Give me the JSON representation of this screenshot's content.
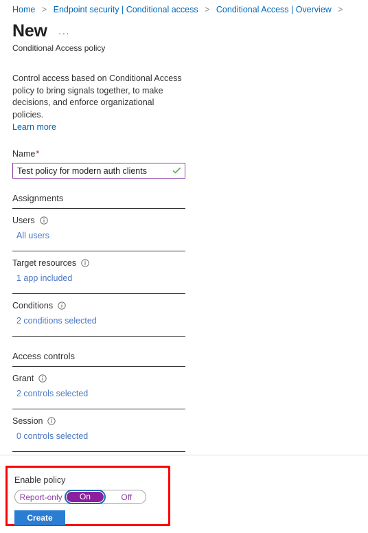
{
  "breadcrumb": {
    "separator": ">",
    "items": [
      {
        "label": "Home"
      },
      {
        "label": "Endpoint security | Conditional access"
      },
      {
        "label": "Conditional Access | Overview"
      }
    ]
  },
  "header": {
    "title": "New",
    "ellipsis": "···",
    "subtitle": "Conditional Access policy"
  },
  "intro": {
    "description": "Control access based on Conditional Access policy to bring signals together, to make decisions, and enforce organizational policies.",
    "learn_more": "Learn more"
  },
  "name_field": {
    "label": "Name",
    "required_marker": "*",
    "value": "Test policy for modern auth clients",
    "placeholder": "",
    "valid_icon": "checkmark-icon",
    "border_color": "#8c3fa0",
    "check_color": "#4caf3f"
  },
  "sections": [
    {
      "heading": "Assignments",
      "rows": [
        {
          "label": "Users",
          "info": "info-icon",
          "value": "All users"
        },
        {
          "label": "Target resources",
          "info": "info-icon",
          "value": "1 app included"
        },
        {
          "label": "Conditions",
          "info": "info-icon",
          "value": "2 conditions selected"
        }
      ]
    },
    {
      "heading": "Access controls",
      "rows": [
        {
          "label": "Grant",
          "info": "info-icon",
          "value": "2 controls selected"
        },
        {
          "label": "Session",
          "info": "info-icon",
          "value": "0 controls selected"
        }
      ]
    }
  ],
  "footer": {
    "enable_label": "Enable policy",
    "toggle": {
      "options": [
        "Report-only",
        "On",
        "Off"
      ],
      "selected": "On",
      "selected_color": "#8c1f9e",
      "focus_color": "#0f6cbd",
      "text_color": "#8c3fa0"
    },
    "create_label": "Create",
    "create_color": "#2b7cd3",
    "highlight_color": "#ff0000"
  },
  "colors": {
    "link": "#0067b8",
    "value_link": "#4a77c4",
    "text": "#323130"
  }
}
